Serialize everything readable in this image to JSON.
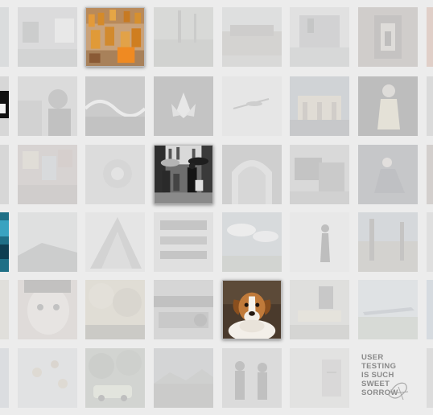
{
  "grid": {
    "text_tile": {
      "line1": "USER TESTING",
      "line2": "IS SUCH SWEET",
      "line3": "SORROW"
    }
  }
}
